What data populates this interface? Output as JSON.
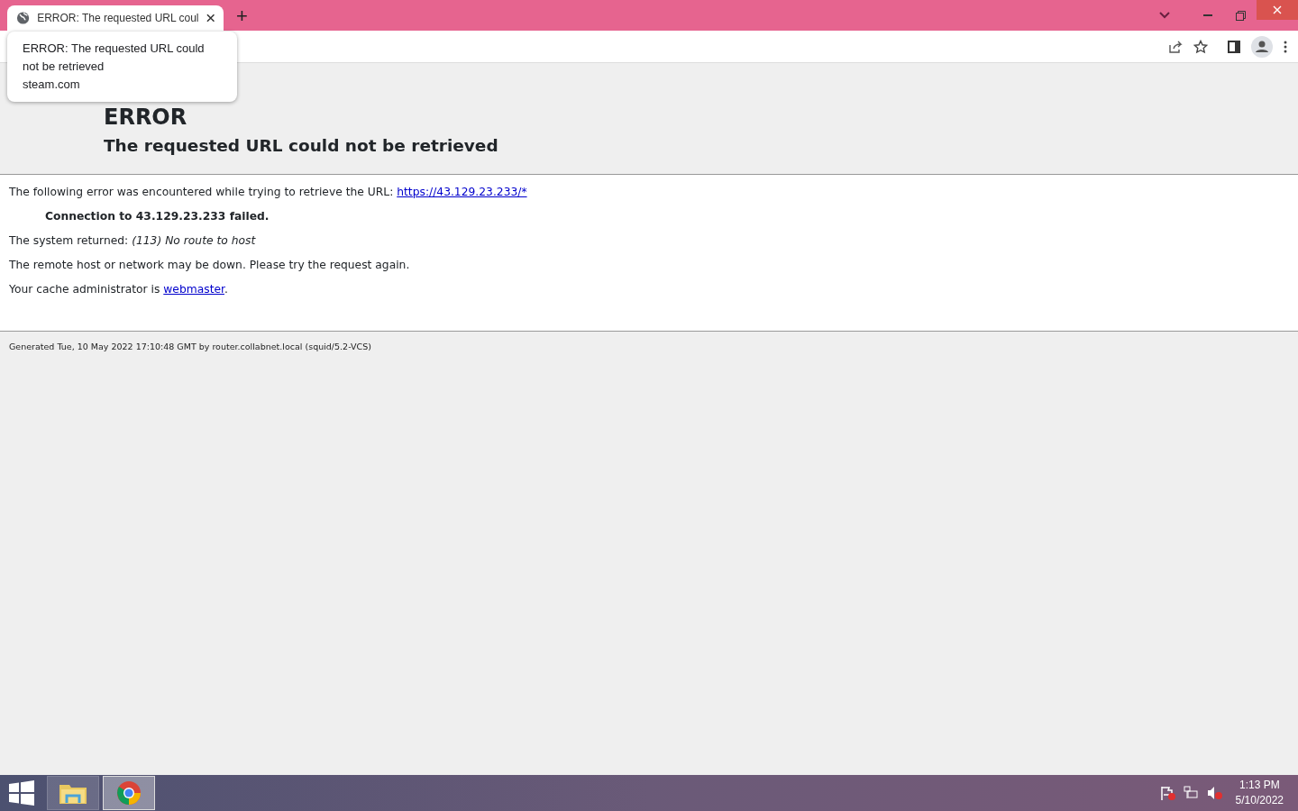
{
  "browser": {
    "tabs": [
      {
        "title": "ERROR: The requested URL coul",
        "selected": true
      }
    ],
    "new_tab": "+",
    "tooltip": {
      "title": "ERROR: The requested URL could not be retrieved",
      "host": "steam.com"
    }
  },
  "page": {
    "heading": "ERROR",
    "subheading": "The requested URL could not be retrieved",
    "intro": "The following error was encountered while trying to retrieve the URL: ",
    "intro_link": "https://43.129.23.233/*",
    "failure": "Connection to 43.129.23.233 failed.",
    "system_label": "The system returned: ",
    "system_error": "(113) No route to host",
    "advice": "The remote host or network may be down. Please try the request again.",
    "admin_label": "Your cache administrator is ",
    "admin_link": "webmaster",
    "admin_end": ".",
    "footer": "Generated Tue, 10 May 2022 17:10:48 GMT by router.collabnet.local (squid/5.2-VCS)"
  },
  "taskbar": {
    "apps": [
      {
        "kind": "explorer",
        "selected": false
      },
      {
        "kind": "chrome",
        "selected": true
      }
    ],
    "time": "1:13 PM",
    "date": "5/10/2022"
  }
}
